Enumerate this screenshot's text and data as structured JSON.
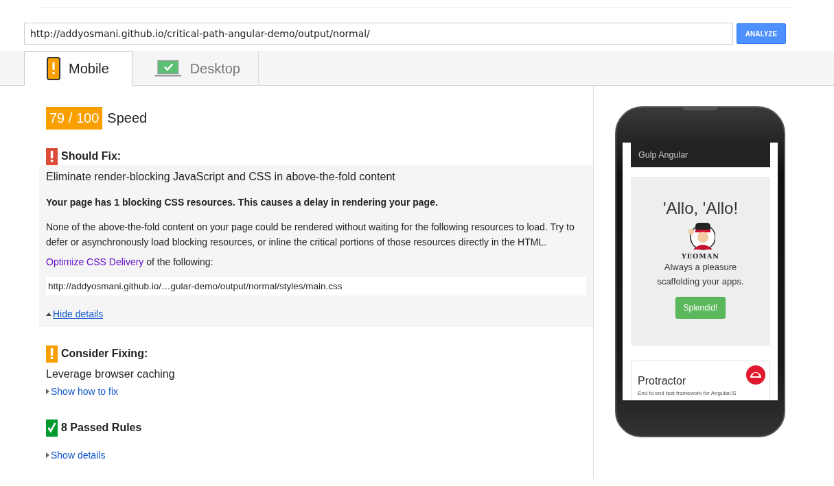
{
  "url_field": {
    "value": "http://addyosmani.github.io/critical-path-angular-demo/output/normal/"
  },
  "analyze_button": "ANALYZE",
  "tabs": [
    {
      "label": "Mobile",
      "kind": "mobile",
      "selected": true
    },
    {
      "label": "Desktop",
      "kind": "desktop",
      "selected": false
    }
  ],
  "score": {
    "value": "79 / 100",
    "label": "Speed"
  },
  "sections": [
    {
      "kind": "should_fix",
      "heading": "Should Fix:",
      "rules": [
        {
          "title": "Eliminate render-blocking JavaScript and CSS in above-the-fold content",
          "expanded": true,
          "summary": "Your page has 1 blocking CSS resources. This causes a delay in rendering your page.",
          "description": "None of the above-the-fold content on your page could be rendered without waiting for the following resources to load. Try to defer or asynchronously load blocking resources, or inline the critical portions of those resources directly in the HTML.",
          "link": "Optimize CSS Delivery",
          "link_suffix": "of the following:",
          "resources": [
            "http://addyosmani.github.io/…gular-demo/output/normal/styles/main.css"
          ],
          "toggle": "Hide details"
        }
      ]
    },
    {
      "kind": "consider_fix",
      "heading": "Consider Fixing:",
      "rules": [
        {
          "title": "Leverage browser caching",
          "expanded": false,
          "toggle": "Show how to fix"
        }
      ]
    },
    {
      "kind": "passed",
      "heading": "8 Passed Rules",
      "toggle": "Show details",
      "expanded": false
    }
  ],
  "preview": {
    "navbar_title": "Gulp Angular",
    "hero_title": "'Allo, 'Allo!",
    "logo_text": "YEOMAN",
    "tagline": "Always a pleasure scaffolding your apps.",
    "button": "Splendid!",
    "card_title": "Protractor",
    "card_text": "End to end test framework for AngularJS"
  }
}
